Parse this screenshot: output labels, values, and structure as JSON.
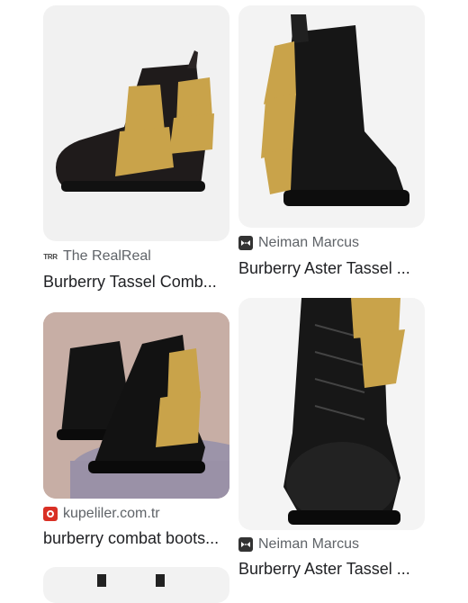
{
  "results": [
    {
      "source": "The RealReal",
      "source_icon": "therealreal-favicon-icon",
      "title": "Burberry Tassel Comb..."
    },
    {
      "source": "Neiman Marcus",
      "source_icon": "neiman-marcus-favicon-icon",
      "title": "Burberry Aster Tassel ..."
    },
    {
      "source": "kupeliler.com.tr",
      "source_icon": "kupeliler-favicon-icon",
      "title": "burberry combat boots..."
    },
    {
      "source": "Neiman Marcus",
      "source_icon": "neiman-marcus-favicon-icon",
      "title": "Burberry Aster Tassel ..."
    }
  ],
  "favicon_text": {
    "therealreal": "TRR"
  },
  "colors": {
    "tassel": "#c9a34a",
    "leather": "#1c1c1c",
    "title": "#202124",
    "source": "#5f6368"
  }
}
